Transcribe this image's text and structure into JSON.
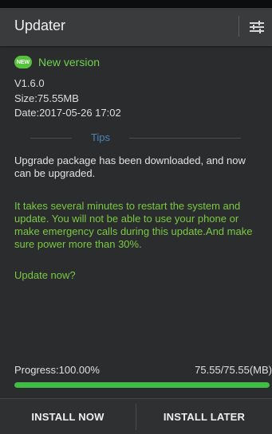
{
  "app": {
    "title": "Updater",
    "settings_icon": "sliders-icon"
  },
  "update": {
    "badge_text": "NEW",
    "badge_icon": "new-badge-icon",
    "heading": "New version",
    "version": "V1.6.0",
    "size": "Size:75.55MB",
    "date": "Date:2017-05-26 17:02"
  },
  "tips": {
    "title": "Tips",
    "downloaded_message": "Upgrade package has been downloaded, and now can be upgraded.",
    "warning_message": "It takes several minutes to restart the system and update. You will not be able to use your phone or make emergency calls during this update.And make sure power more than 30%.",
    "prompt": "Update now?"
  },
  "progress": {
    "label": "Progress:100.00%",
    "size": "75.55/75.55(MB)",
    "percent": 100
  },
  "actions": {
    "install_now": "INSTALL NOW",
    "install_later": "INSTALL LATER"
  },
  "colors": {
    "accent_green": "#6fd24a",
    "tips_blue": "#4a86b8",
    "progress_green": "#3fbd45",
    "appbar": "#3a3b3d",
    "background": "#2b2c2e"
  }
}
